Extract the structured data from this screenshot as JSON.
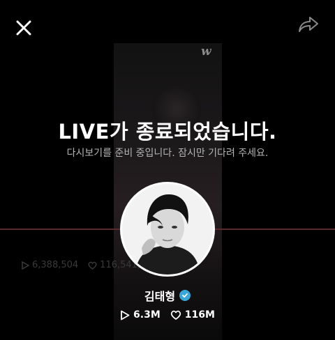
{
  "header": {
    "close_icon": "close-icon",
    "share_icon": "share-icon"
  },
  "video": {
    "watermark": "w"
  },
  "background_stats": {
    "plays": "6,388,504",
    "likes": "116,541,..."
  },
  "message": {
    "title": "LIVE가 종료되었습니다.",
    "subtitle": "다시보기를 준비 중입니다. 잠시만 기다려 주세요."
  },
  "profile": {
    "name": "김태형",
    "verified_icon": "verified-badge-icon",
    "plays": "6.3M",
    "likes": "116M"
  },
  "colors": {
    "background": "#000000",
    "verified": "#3aa6d8",
    "progress": "#5a2a2e"
  }
}
